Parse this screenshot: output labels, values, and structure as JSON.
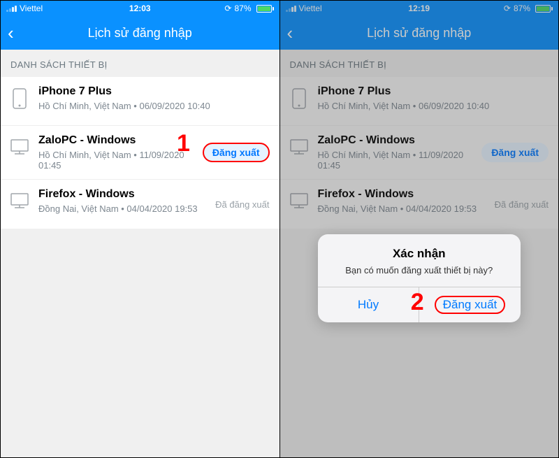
{
  "left": {
    "statusbar": {
      "carrier": "Viettel",
      "time": "12:03",
      "battery_pct": "87%"
    },
    "navbar": {
      "title": "Lịch sử đăng nhập"
    },
    "section_header": "DANH SÁCH THIẾT BỊ",
    "devices": [
      {
        "name": "iPhone 7 Plus",
        "meta": "Hồ Chí Minh, Việt Nam • 06/09/2020 10:40",
        "action": null,
        "type": "phone"
      },
      {
        "name": "ZaloPC - Windows",
        "meta": "Hồ Chí Minh, Việt Nam • 11/09/2020 01:45",
        "action": "Đăng xuất",
        "type": "monitor"
      },
      {
        "name": "Firefox - Windows",
        "meta": "Đồng Nai, Việt Nam • 04/04/2020 19:53",
        "status": "Đã đăng xuất",
        "type": "monitor"
      }
    ],
    "annotation": "1"
  },
  "right": {
    "statusbar": {
      "carrier": "Viettel",
      "time": "12:19",
      "battery_pct": "87%"
    },
    "navbar": {
      "title": "Lịch sử đăng nhập"
    },
    "section_header": "DANH SÁCH THIẾT BỊ",
    "devices": [
      {
        "name": "iPhone 7 Plus",
        "meta": "Hồ Chí Minh, Việt Nam • 06/09/2020 10:40",
        "action": null,
        "type": "phone"
      },
      {
        "name": "ZaloPC - Windows",
        "meta": "Hồ Chí Minh, Việt Nam • 11/09/2020 01:45",
        "action": "Đăng xuất",
        "type": "monitor"
      },
      {
        "name": "Firefox - Windows",
        "meta": "Đồng Nai, Việt Nam • 04/04/2020 19:53",
        "status": "Đã đăng xuất",
        "type": "monitor"
      }
    ],
    "alert": {
      "title": "Xác nhận",
      "message": "Bạn có muốn đăng xuất thiết bị này?",
      "cancel": "Hủy",
      "confirm": "Đăng xuất"
    },
    "annotation": "2"
  }
}
